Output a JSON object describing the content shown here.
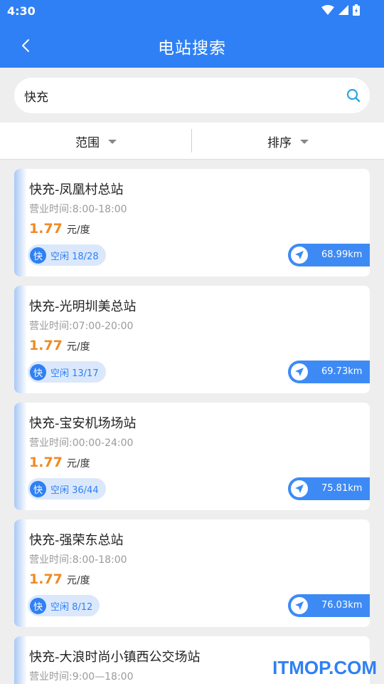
{
  "status_bar": {
    "time": "4:30"
  },
  "header": {
    "title": "电站搜索"
  },
  "search": {
    "value": "快充"
  },
  "filters": {
    "range_label": "范围",
    "sort_label": "排序"
  },
  "stations": [
    {
      "name": "快充-凤凰村总站",
      "hours": "营业时间:8:00-18:00",
      "price": "1.77",
      "unit": "元/度",
      "type": "快",
      "availability": "空闲 18/28",
      "distance": "68.99km"
    },
    {
      "name": "快充-光明圳美总站",
      "hours": "营业时间:07:00-20:00",
      "price": "1.77",
      "unit": "元/度",
      "type": "快",
      "availability": "空闲 13/17",
      "distance": "69.73km"
    },
    {
      "name": "快充-宝安机场场站",
      "hours": "营业时间:00:00-24:00",
      "price": "1.77",
      "unit": "元/度",
      "type": "快",
      "availability": "空闲 36/44",
      "distance": "75.81km"
    },
    {
      "name": "快充-强荣东总站",
      "hours": "营业时间:8:00-18:00",
      "price": "1.77",
      "unit": "元/度",
      "type": "快",
      "availability": "空闲 8/12",
      "distance": "76.03km"
    },
    {
      "name": "快充-大浪时尚小镇西公交场站",
      "hours": "营业时间:9:00—18:00"
    }
  ],
  "watermark": "ITMOP.COM",
  "colors": {
    "primary": "#2f80f4",
    "price": "#f08a24"
  }
}
